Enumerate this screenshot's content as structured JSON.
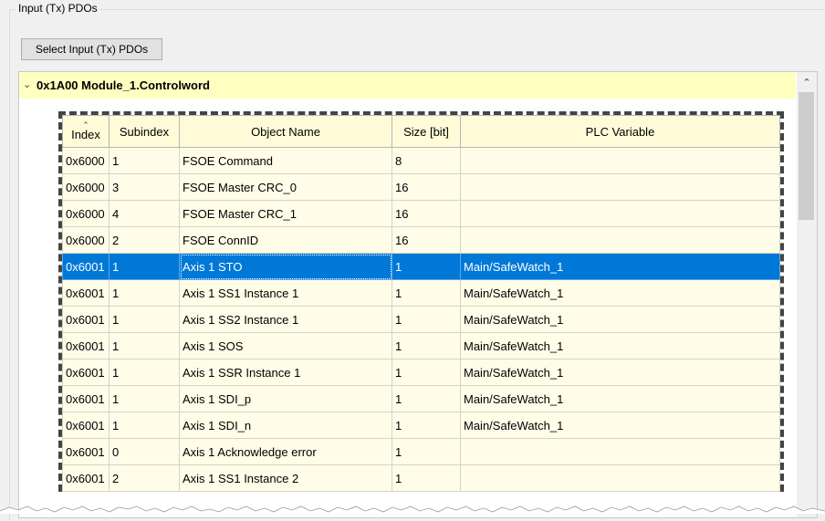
{
  "group": {
    "title": "Input (Tx) PDOs"
  },
  "toolbar": {
    "select_button_label": "Select Input (Tx) PDOs"
  },
  "module": {
    "title": "0x1A00 Module_1.Controlword",
    "expanded": true
  },
  "table": {
    "columns": [
      "Index",
      "Subindex",
      "Object Name",
      "Size [bit]",
      "PLC Variable"
    ],
    "rows": [
      {
        "index": "0x6000",
        "subindex": "1",
        "name": "FSOE Command",
        "size": "8",
        "plc": ""
      },
      {
        "index": "0x6000",
        "subindex": "3",
        "name": "FSOE Master CRC_0",
        "size": "16",
        "plc": ""
      },
      {
        "index": "0x6000",
        "subindex": "4",
        "name": "FSOE Master CRC_1",
        "size": "16",
        "plc": ""
      },
      {
        "index": "0x6000",
        "subindex": "2",
        "name": "FSOE ConnID",
        "size": "16",
        "plc": ""
      },
      {
        "index": "0x6001",
        "subindex": "1",
        "name": "Axis 1 STO",
        "size": "1",
        "plc": "Main/SafeWatch_1",
        "selected": true
      },
      {
        "index": "0x6001",
        "subindex": "1",
        "name": "Axis 1 SS1 Instance 1",
        "size": "1",
        "plc": "Main/SafeWatch_1"
      },
      {
        "index": "0x6001",
        "subindex": "1",
        "name": "Axis 1 SS2 Instance 1",
        "size": "1",
        "plc": "Main/SafeWatch_1"
      },
      {
        "index": "0x6001",
        "subindex": "1",
        "name": "Axis 1 SOS",
        "size": "1",
        "plc": "Main/SafeWatch_1"
      },
      {
        "index": "0x6001",
        "subindex": "1",
        "name": "Axis 1 SSR Instance 1",
        "size": "1",
        "plc": "Main/SafeWatch_1"
      },
      {
        "index": "0x6001",
        "subindex": "1",
        "name": "Axis 1 SDI_p",
        "size": "1",
        "plc": "Main/SafeWatch_1"
      },
      {
        "index": "0x6001",
        "subindex": "1",
        "name": "Axis 1 SDI_n",
        "size": "1",
        "plc": "Main/SafeWatch_1"
      },
      {
        "index": "0x6001",
        "subindex": "0",
        "name": "Axis 1 Acknowledge error",
        "size": "1",
        "plc": ""
      },
      {
        "index": "0x6001",
        "subindex": "2",
        "name": "Axis 1 SS1 Instance 2",
        "size": "1",
        "plc": ""
      }
    ]
  },
  "icons": {
    "expand": "chevron-down-icon",
    "scroll_up": "arrow-up-icon",
    "sort": "sort-caret-icon"
  }
}
